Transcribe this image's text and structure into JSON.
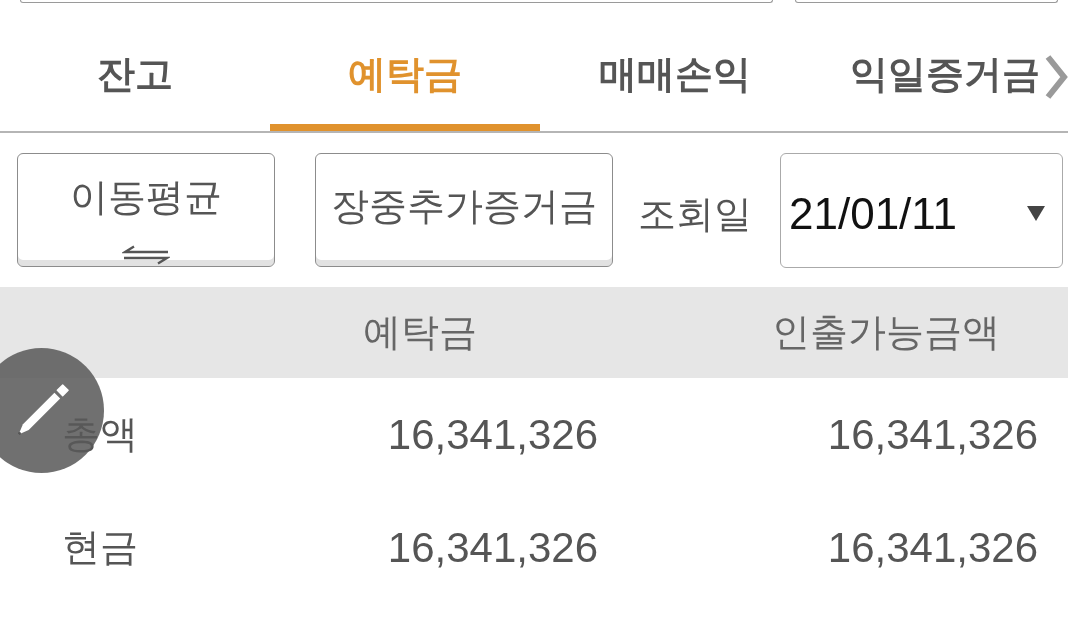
{
  "tabs": [
    {
      "label": "잔고",
      "selected": false
    },
    {
      "label": "예탁금",
      "selected": true
    },
    {
      "label": "매매손익",
      "selected": false
    },
    {
      "label": "익일증거금",
      "selected": false
    }
  ],
  "filters": {
    "buttons": [
      {
        "label": "이동평균",
        "kind": "toggle"
      },
      {
        "label": "장중추가증거금",
        "kind": "plain"
      }
    ],
    "date_label": "조회일",
    "date_select": {
      "value": "21/01/11"
    }
  },
  "table": {
    "columns": [
      "예탁금",
      "인출가능금액"
    ],
    "rows": [
      {
        "label": "총액",
        "values": [
          "16,341,326",
          "16,341,326"
        ]
      },
      {
        "label": "현금",
        "values": [
          "16,341,326",
          "16,341,326"
        ]
      }
    ]
  }
}
